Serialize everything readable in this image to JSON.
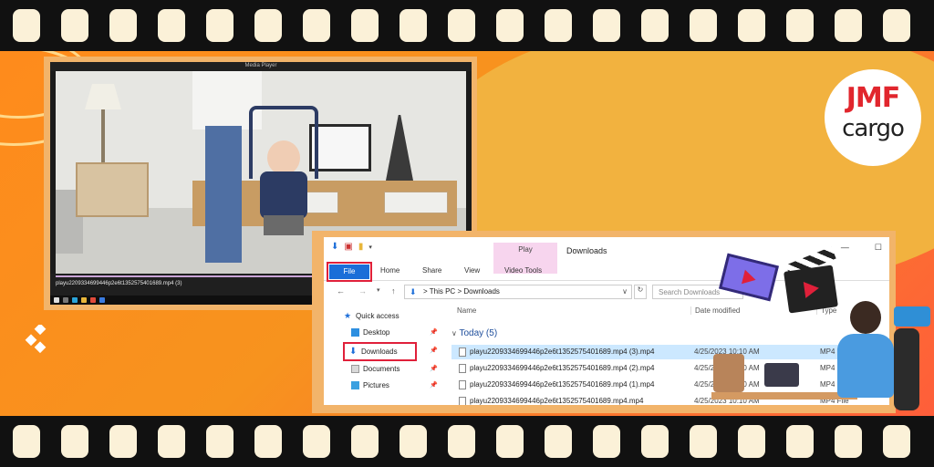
{
  "brand": {
    "logo_line1": "JMF",
    "logo_line2": "cargo",
    "colors": {
      "accent_red": "#e1262d",
      "orange": "#f7931e",
      "highlight": "#e0203a",
      "selection": "#cce8ff"
    }
  },
  "player": {
    "window_title": "Media Player",
    "filename": "playu2209334699446p2e6t1352575401689.mp4 (3)",
    "progress_fraction": 0.9,
    "controls": [
      "shuffle-icon",
      "previous-icon",
      "rewind-icon",
      "pause-icon",
      "forward-icon",
      "next-icon",
      "fullscreen-icon"
    ]
  },
  "explorer": {
    "window_title": "Downloads",
    "context_tab": "Play",
    "ribbon_tabs": {
      "file": "File",
      "home": "Home",
      "share": "Share",
      "view": "View",
      "video_tools": "Video Tools"
    },
    "address": {
      "this_pc": "This PC",
      "sep": ">",
      "folder": "Downloads"
    },
    "search_placeholder": "Search Downloads",
    "nav": {
      "quick_access": "Quick access",
      "desktop": "Desktop",
      "downloads": "Downloads",
      "documents": "Documents",
      "pictures": "Pictures"
    },
    "columns": {
      "name": "Name",
      "date": "Date modified",
      "type": "Type"
    },
    "group_label": "Today (5)",
    "files": [
      {
        "name": "playu2209334699446p2e6t1352575401689.mp4 (3).mp4",
        "date": "4/25/2023 10:10 AM",
        "type": "MP4 File"
      },
      {
        "name": "playu2209334699446p2e6t1352575401689.mp4 (2).mp4",
        "date": "4/25/2023 10:10 AM",
        "type": "MP4 File"
      },
      {
        "name": "playu2209334699446p2e6t1352575401689.mp4 (1).mp4",
        "date": "4/25/2023 10:10 AM",
        "type": "MP4 File"
      },
      {
        "name": "playu2209334699446p2e6t1352575401689.mp4.mp4",
        "date": "4/25/2023 10:10 AM",
        "type": "MP4 File"
      }
    ]
  }
}
